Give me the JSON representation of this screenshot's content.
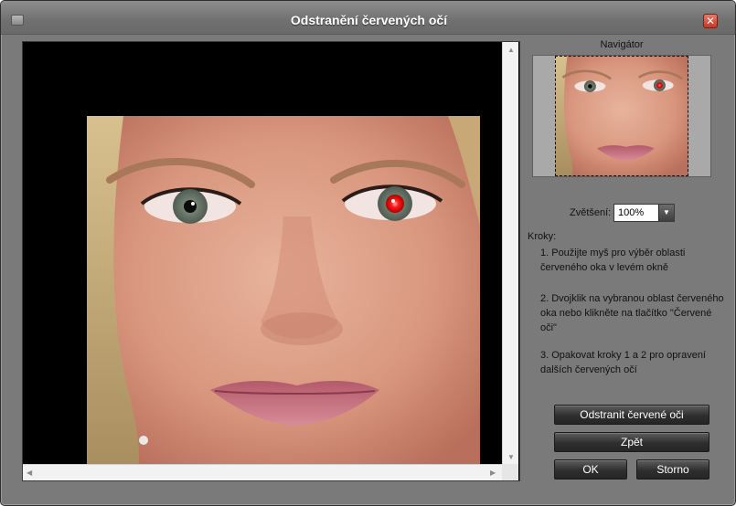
{
  "window": {
    "title": "Odstranění červených očí"
  },
  "navigator": {
    "label": "Navigátor"
  },
  "zoom": {
    "label": "Zvětšení:",
    "value": "100%"
  },
  "steps": {
    "label": "Kroky:",
    "items": [
      "1. Použijte myš pro výběr oblasti červeného oka v levém okně",
      "2. Dvojklik na vybranou oblast červeného oka nebo klikněte na tlačítko \"Červené oči\"",
      "3. Opakovat kroky 1 a 2 pro opravení dalších červených očí"
    ]
  },
  "buttons": {
    "remove_red_eye": "Odstranit červené oči",
    "back": "Zpět",
    "ok": "OK",
    "cancel": "Storno"
  },
  "colors": {
    "window_bg": "#7a7a7a",
    "button_bg": "#2f2f2f",
    "red_eye": "#ff1a1a",
    "close_button": "#c23a25"
  }
}
